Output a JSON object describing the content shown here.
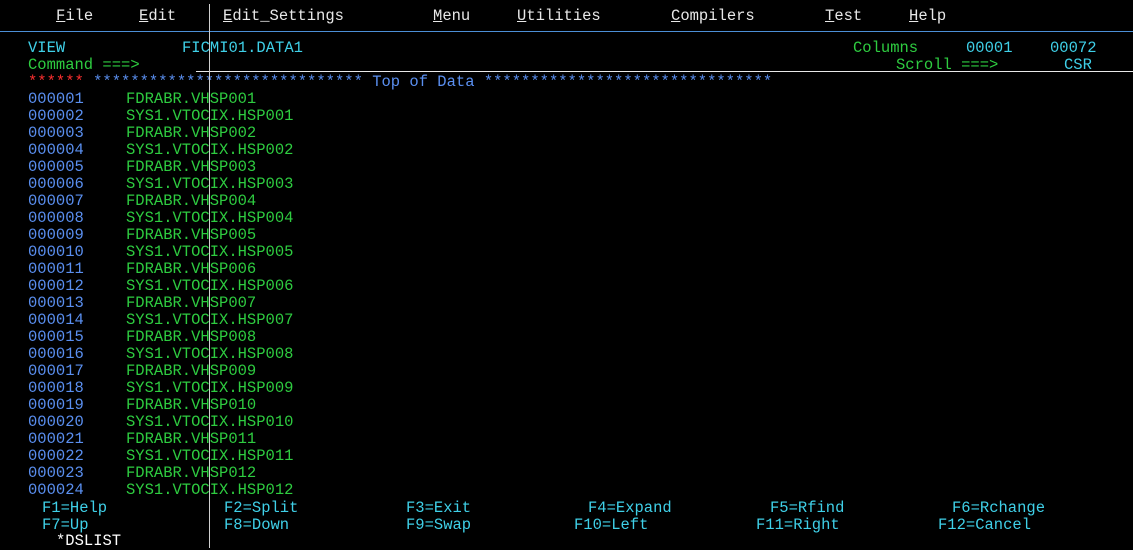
{
  "menu": {
    "items": [
      {
        "hot": "F",
        "rest": "ile"
      },
      {
        "hot": "E",
        "rest": "dit"
      },
      {
        "hot": "E",
        "rest": "dit_Settings"
      },
      {
        "hot": "M",
        "rest": "enu"
      },
      {
        "hot": "U",
        "rest": "tilities"
      },
      {
        "hot": "C",
        "rest": "ompilers"
      },
      {
        "hot": "T",
        "rest": "est"
      },
      {
        "hot": "H",
        "rest": "elp"
      }
    ]
  },
  "header": {
    "mode": "VIEW",
    "dataset": "FICMI01.DATA1",
    "columns_label": "Columns",
    "columns_from": "00001",
    "columns_to": "00072",
    "command_label": "Command ===>",
    "command_value": "",
    "scroll_label": "Scroll ===>",
    "scroll_value": "CSR"
  },
  "top_of_data": {
    "marker": "******",
    "stars_left": "*****************************",
    "label": "Top of Data",
    "stars_right": "*******************************"
  },
  "rows": [
    {
      "num": "000001",
      "text": "FDRABR.VHSP001"
    },
    {
      "num": "000002",
      "text": "SYS1.VTOCIX.HSP001"
    },
    {
      "num": "000003",
      "text": "FDRABR.VHSP002"
    },
    {
      "num": "000004",
      "text": "SYS1.VTOCIX.HSP002"
    },
    {
      "num": "000005",
      "text": "FDRABR.VHSP003"
    },
    {
      "num": "000006",
      "text": "SYS1.VTOCIX.HSP003"
    },
    {
      "num": "000007",
      "text": "FDRABR.VHSP004"
    },
    {
      "num": "000008",
      "text": "SYS1.VTOCIX.HSP004"
    },
    {
      "num": "000009",
      "text": "FDRABR.VHSP005"
    },
    {
      "num": "000010",
      "text": "SYS1.VTOCIX.HSP005"
    },
    {
      "num": "000011",
      "text": "FDRABR.VHSP006"
    },
    {
      "num": "000012",
      "text": "SYS1.VTOCIX.HSP006"
    },
    {
      "num": "000013",
      "text": "FDRABR.VHSP007"
    },
    {
      "num": "000014",
      "text": "SYS1.VTOCIX.HSP007"
    },
    {
      "num": "000015",
      "text": "FDRABR.VHSP008"
    },
    {
      "num": "000016",
      "text": "SYS1.VTOCIX.HSP008"
    },
    {
      "num": "000017",
      "text": "FDRABR.VHSP009"
    },
    {
      "num": "000018",
      "text": "SYS1.VTOCIX.HSP009"
    },
    {
      "num": "000019",
      "text": "FDRABR.VHSP010"
    },
    {
      "num": "000020",
      "text": "SYS1.VTOCIX.HSP010"
    },
    {
      "num": "000021",
      "text": "FDRABR.VHSP011"
    },
    {
      "num": "000022",
      "text": "SYS1.VTOCIX.HSP011"
    },
    {
      "num": "000023",
      "text": "FDRABR.VHSP012"
    },
    {
      "num": "000024",
      "text": "SYS1.VTOCIX.HSP012"
    }
  ],
  "fkeys": [
    "F1=Help",
    "F2=Split",
    "F3=Exit",
    "F4=Expand",
    "F5=Rfind",
    "F6=Rchange",
    "F7=Up",
    "F8=Down",
    "F9=Swap",
    "F10=Left",
    "F11=Right",
    "F12=Cancel"
  ],
  "status": {
    "panel": "*DSLIST"
  },
  "colors": {
    "background": "#000000",
    "menu_text": "#e8e8e8",
    "cyan": "#3fd0e8",
    "green": "#2ecc40",
    "blue": "#5a8ff0",
    "red": "#ff3030"
  }
}
